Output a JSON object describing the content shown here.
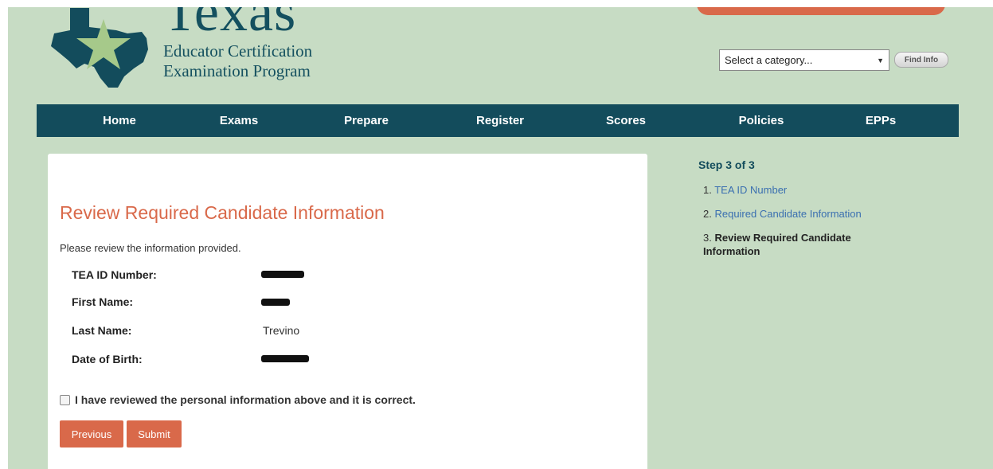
{
  "header": {
    "brand_title": "Texas",
    "brand_sub_line1": "Educator Certification",
    "brand_sub_line2": "Examination Program",
    "category_placeholder": "Select a category...",
    "find_info_label": "Find Info"
  },
  "nav": {
    "items": [
      {
        "label": "Home"
      },
      {
        "label": "Exams"
      },
      {
        "label": "Prepare"
      },
      {
        "label": "Register"
      },
      {
        "label": "Scores"
      },
      {
        "label": "Policies"
      },
      {
        "label": "EPPs"
      }
    ]
  },
  "main": {
    "title": "Review Required Candidate Information",
    "intro": "Please review the information provided.",
    "fields": [
      {
        "label": "TEA ID Number:",
        "value": ""
      },
      {
        "label": "First Name:",
        "value": ""
      },
      {
        "label": "Last Name:",
        "value": "Trevino"
      },
      {
        "label": "Date of Birth:",
        "value": ""
      }
    ],
    "confirm_label": "I have reviewed the personal information above and it is correct.",
    "previous_label": "Previous",
    "submit_label": "Submit"
  },
  "sidebar": {
    "step_title": "Step 3 of 3",
    "steps": [
      {
        "num": "1.",
        "label": "TEA ID Number"
      },
      {
        "num": "2.",
        "label": "Required Candidate Information"
      },
      {
        "num": "3.",
        "label": "Review Required Candidate Information"
      }
    ]
  },
  "colors": {
    "background": "#c7dcc4",
    "nav": "#134c5c",
    "accent": "#d9694a",
    "link": "#3a6fb0"
  }
}
